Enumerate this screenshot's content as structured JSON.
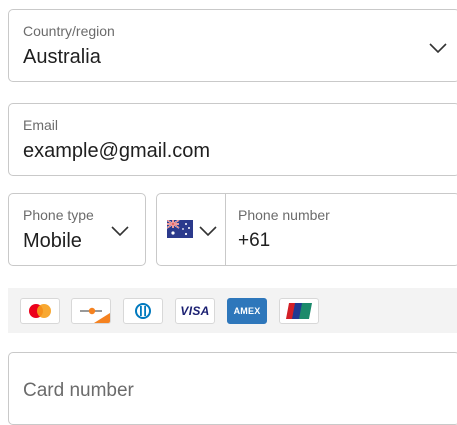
{
  "country": {
    "label": "Country/region",
    "value": "Australia",
    "icon": "chevron-down-icon"
  },
  "email": {
    "label": "Email",
    "value": "example@gmail.com"
  },
  "phone_type": {
    "label": "Phone type",
    "value": "Mobile",
    "icon": "chevron-down-icon"
  },
  "phone_number": {
    "label": "Phone number",
    "value": "+61",
    "country_flag": "australia-flag-icon"
  },
  "cards": [
    {
      "name": "mastercard",
      "icon": "mastercard-icon"
    },
    {
      "name": "discover",
      "icon": "discover-icon"
    },
    {
      "name": "diners-club",
      "icon": "diners-club-icon"
    },
    {
      "name": "visa",
      "label": "VISA",
      "icon": "visa-icon"
    },
    {
      "name": "amex",
      "label": "AMEX",
      "icon": "amex-icon"
    },
    {
      "name": "unionpay",
      "label": "UnionPay",
      "icon": "unionpay-icon"
    }
  ],
  "card_number": {
    "placeholder": "Card number"
  },
  "colors": {
    "border": "#c9c9c9",
    "label": "#6b6b6b",
    "text": "#1f1f1f",
    "strip_bg": "#f3f3f3",
    "visa_blue": "#1a1f71",
    "amex_blue": "#2e77bb",
    "mastercard_red": "#eb001b",
    "mastercard_orange": "#f79e1b"
  }
}
